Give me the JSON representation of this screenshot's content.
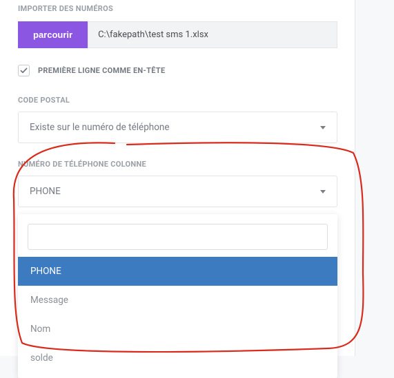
{
  "import": {
    "label": "IMPORTER DES NUMÉROS",
    "browse": "parcourir",
    "path": "C:\\fakepath\\test sms 1.xlsx"
  },
  "header_checkbox": {
    "label": "PREMIÈRE LIGNE COMME EN-TÊTE",
    "checked": true
  },
  "postal": {
    "label": "CODE POSTAL",
    "value": "Existe sur le numéro de téléphone"
  },
  "phone_col": {
    "label": "NUMÉRO DE TÉLÉPHONE COLONNE",
    "value": "PHONE",
    "search": "",
    "options": [
      "PHONE",
      "Message",
      "Nom",
      "solde"
    ],
    "selected": "PHONE"
  }
}
